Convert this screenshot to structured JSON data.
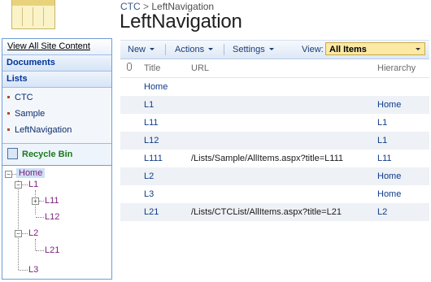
{
  "breadcrumb": {
    "site": "CTC",
    "separator": ">",
    "current": "LeftNavigation"
  },
  "page_title": "LeftNavigation",
  "leftnav": {
    "view_all": "View All Site Content",
    "documents_header": "Documents",
    "lists_header": "Lists",
    "lists": [
      "CTC",
      "Sample",
      "LeftNavigation"
    ],
    "recycle_bin": "Recycle Bin"
  },
  "tree": {
    "home": "Home",
    "l1": "L1",
    "l11": "L11",
    "l12": "L12",
    "l2": "L2",
    "l21": "L21",
    "l3": "L3"
  },
  "toolbar": {
    "new_label": "New",
    "actions_label": "Actions",
    "settings_label": "Settings",
    "view_label": "View:",
    "view_value": "All Items"
  },
  "grid": {
    "headers": {
      "title": "Title",
      "url": "URL",
      "hierarchy": "Hierarchy"
    },
    "rows": [
      {
        "title": "Home",
        "url": "",
        "hierarchy": ""
      },
      {
        "title": "L1",
        "url": "",
        "hierarchy": "Home"
      },
      {
        "title": "L11",
        "url": "",
        "hierarchy": "L1"
      },
      {
        "title": "L12",
        "url": "",
        "hierarchy": "L1"
      },
      {
        "title": "L111",
        "url": "/Lists/Sample/AllItems.aspx?title=L111",
        "hierarchy": "L11"
      },
      {
        "title": "L2",
        "url": "",
        "hierarchy": "Home"
      },
      {
        "title": "L3",
        "url": "",
        "hierarchy": "Home"
      },
      {
        "title": "L21",
        "url": "/Lists/CTCList/AllItems.aspx?title=L21",
        "hierarchy": "L2"
      }
    ]
  },
  "colors": {
    "nav_border": "#6f9dd9",
    "link": "#0f3b8a",
    "tree_link": "#7a1f7a",
    "view_select_bg": "#fbe9a4"
  }
}
